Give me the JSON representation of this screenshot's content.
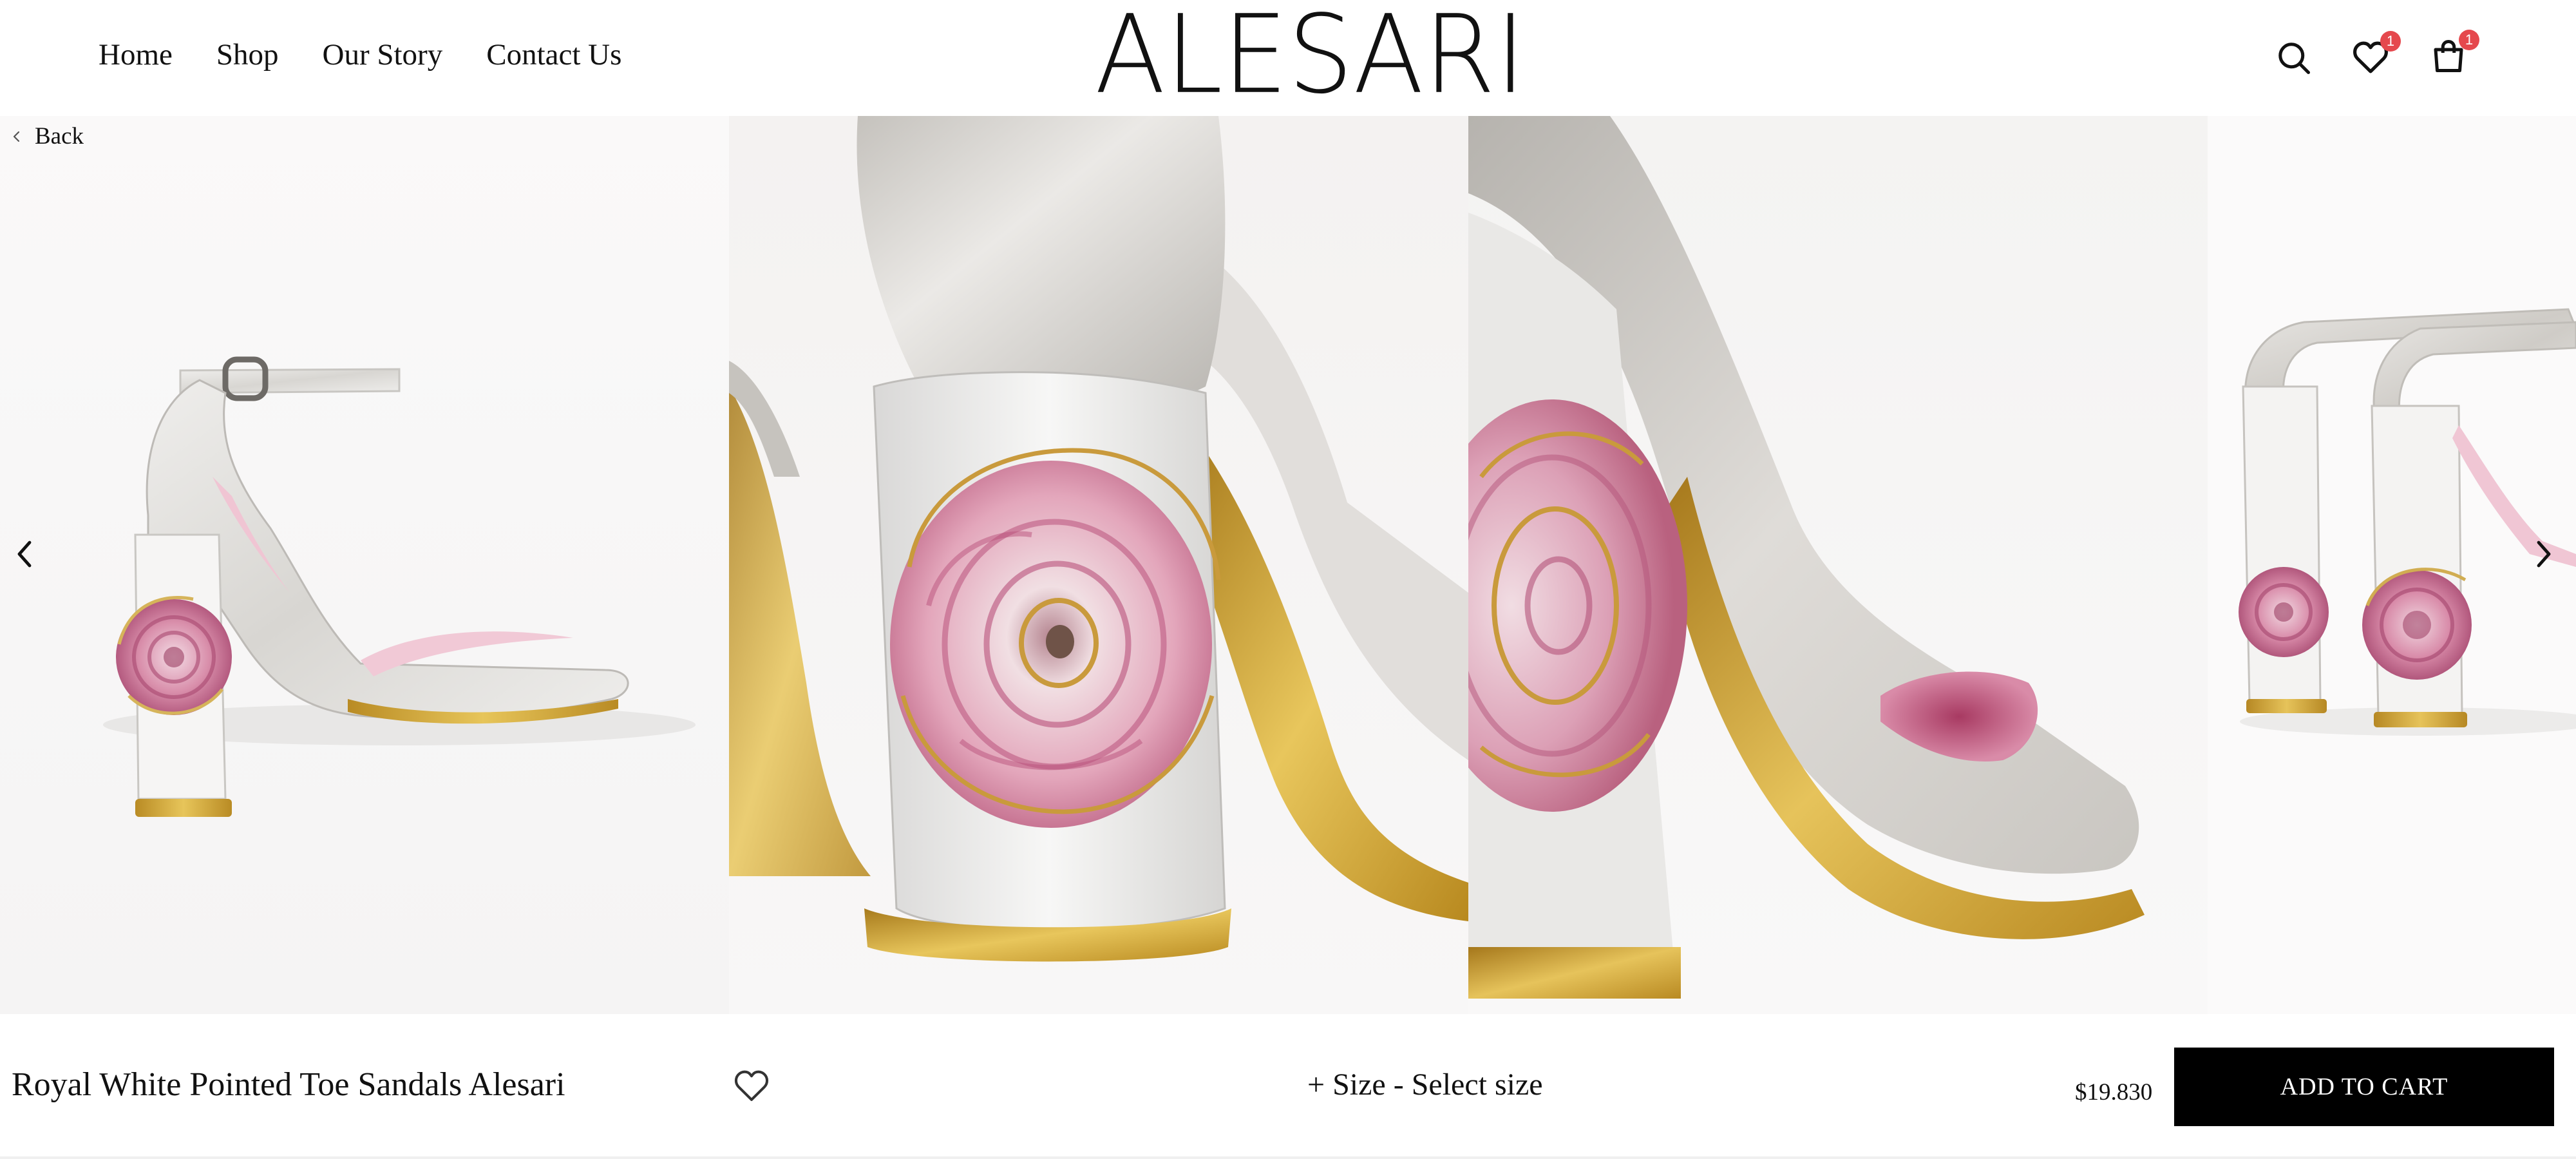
{
  "nav": {
    "items": [
      "Home",
      "Shop",
      "Our Story",
      "Contact Us"
    ]
  },
  "brand": {
    "letters": [
      "A",
      "L",
      "E",
      "S",
      "A",
      "R",
      "I"
    ]
  },
  "header_icons": {
    "search": "search-icon",
    "wishlist": "heart-icon",
    "wishlist_count": "1",
    "cart": "shopping-bag-icon",
    "cart_count": "1",
    "badge_color": "#e5484d"
  },
  "back": {
    "label": "Back"
  },
  "gallery": {
    "prev_icon": "chevron-left-icon",
    "next_icon": "chevron-right-icon"
  },
  "product": {
    "name": "Royal White Pointed Toe Sandals Alesari",
    "size_label": "+ Size - Select size",
    "price": "$19.830",
    "add_to_cart": "ADD TO CART"
  },
  "colors": {
    "accent": "#000000",
    "gold": "#c9a13a",
    "rose_pink": "#c97a99"
  }
}
